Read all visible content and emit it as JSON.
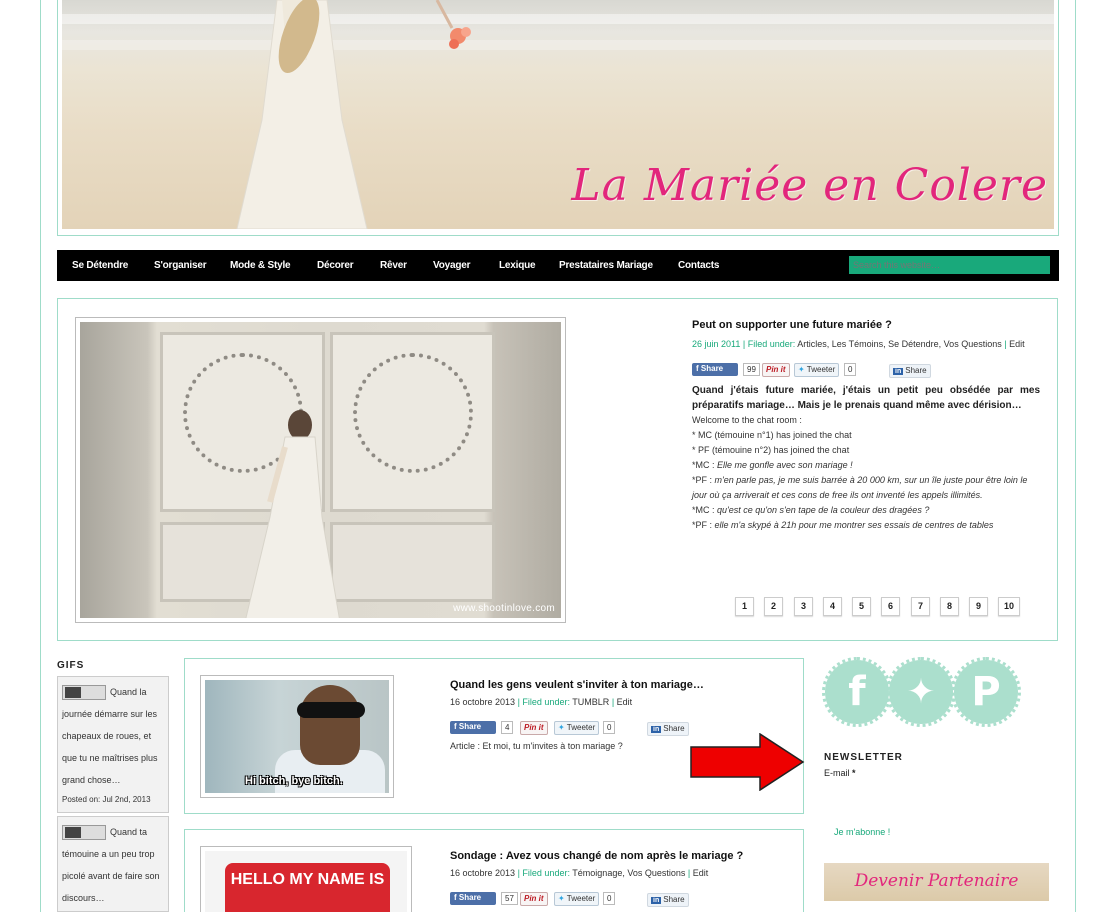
{
  "site": {
    "title": "La Mariée en Colere"
  },
  "nav": {
    "items": [
      "Se Détendre",
      "S'organiser",
      "Mode & Style",
      "Décorer",
      "Rêver",
      "Voyager",
      "Lexique",
      "Prestataires Mariage",
      "Contacts"
    ],
    "search_placeholder": "Search this website…"
  },
  "featured": {
    "title": "Peut on supporter une future mariée ?",
    "date": "26 juin 2011",
    "filed_label": "Filed under:",
    "categories": "Articles, Les Témoins, Se Détendre, Vos Questions",
    "edit": "Edit",
    "share": {
      "fb_label": "Share",
      "fb_count": "99",
      "pin_label": "Pin it",
      "tweet_label": "Tweeter",
      "tweet_count": "0",
      "share_label": "Share"
    },
    "excerpt_bold": "Quand j'étais future mariée, j'étais un petit peu obsédée par mes préparatifs mariage… Mais je le prenais quand même avec dérision…",
    "line1": "Welcome to the chat room :",
    "line2": "* MC (témouine n°1)  has joined the chat",
    "line3": "* PF (témouine n°2) has joined the chat",
    "line4_prefix": "*MC : ",
    "line4_italic": "Elle me gonfle avec son mariage !",
    "line5_prefix": "*PF : ",
    "line5_italic": "m'en parle pas, je me suis barrée à 20 000 km, sur un île juste pour être loin le jour où ça arriverait et ces cons de free ils ont inventé les appels illimités.",
    "line6_prefix": "*MC : ",
    "line6_italic": "qu'est ce qu'on s'en tape de la couleur des dragées ?",
    "line7_prefix": "*PF : ",
    "line7_italic": "elle m'a skypé à 21h pour me montrer ses essais de centres de tables",
    "photo_watermark": "www.shootinlove.com",
    "pages": [
      "1",
      "2",
      "3",
      "4",
      "5",
      "6",
      "7",
      "8",
      "9",
      "10"
    ]
  },
  "gifs": {
    "heading": "GIFS",
    "items": [
      {
        "text": "Quand la journée démarre sur les chapeaux de roues, et que tu ne maîtrises plus grand chose…",
        "posted": "Posted on: Jul 2nd, 2013"
      },
      {
        "text": "Quand ta témouine a un peu trop picolé avant de faire son discours…"
      }
    ]
  },
  "posts": [
    {
      "title": "Quand les gens veulent s'inviter à ton mariage…",
      "date": "16 octobre 2013",
      "filed_label": "Filed under:",
      "categories": "TUMBLR",
      "edit": "Edit",
      "share": {
        "fb_label": "Share",
        "fb_count": "4",
        "pin_label": "Pin it",
        "tweet_label": "Tweeter",
        "tweet_count": "0",
        "share_label": "Share"
      },
      "excerpt": "Article : Et moi, tu m'invites à ton mariage ?",
      "image_caption": "Hi bitch, bye bitch."
    },
    {
      "title": "Sondage : Avez vous changé de nom après le mariage ?",
      "date": "16 octobre 2013",
      "filed_label": "Filed under:",
      "categories": "Témoignage, Vos Questions",
      "edit": "Edit",
      "share": {
        "fb_label": "Share",
        "fb_count": "57",
        "pin_label": "Pin it",
        "tweet_label": "Tweeter",
        "tweet_count": "0",
        "share_label": "Share"
      },
      "image_caption": "HELLO MY NAME IS"
    }
  ],
  "sidebar": {
    "social_icons": [
      "facebook-icon",
      "twitter-icon",
      "pinterest-icon"
    ],
    "newsletter_heading": "NEWSLETTER",
    "email_label": "E-mail",
    "required_mark": "*",
    "subscribe_label": "Je m'abonne !",
    "partner_label": "Devenir Partenaire"
  },
  "colors": {
    "accent": "#19a97b",
    "border": "#9fdcc9",
    "brand_pink": "#e2267c",
    "nav_bg": "#000000",
    "arrow": "#ee0000"
  }
}
